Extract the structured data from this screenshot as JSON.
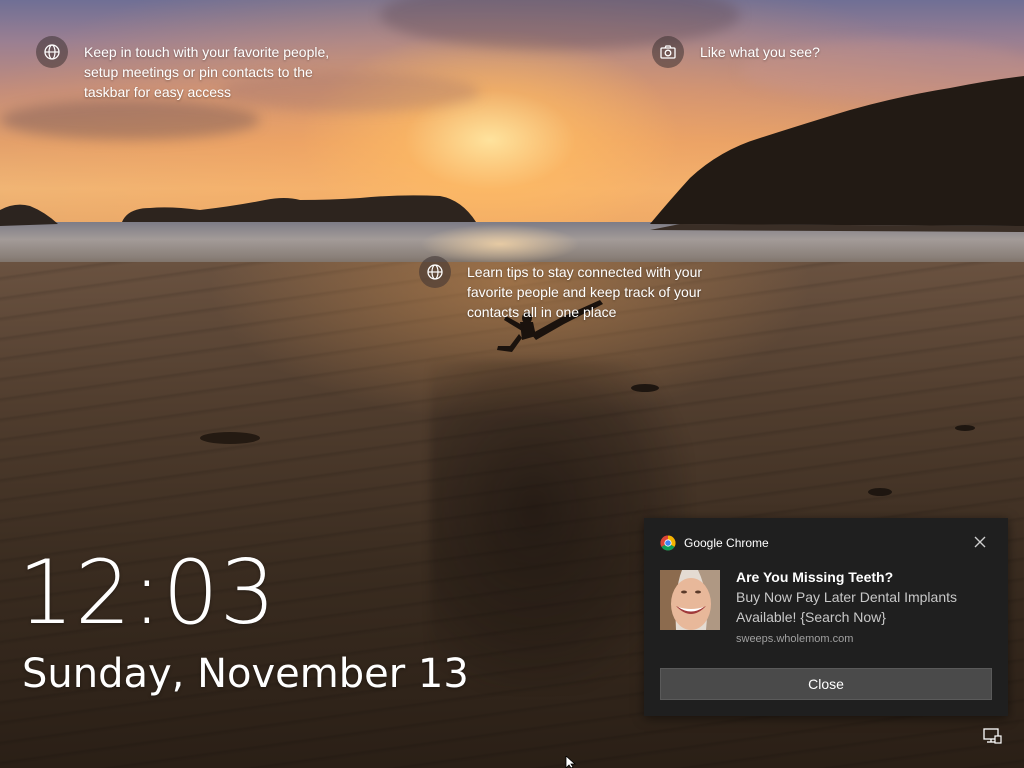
{
  "lock_screen": {
    "spotlight_tips": [
      {
        "icon": "globe-icon",
        "text": "Keep in touch with your favorite people,\nsetup meetings or pin contacts to the\ntaskbar for easy access"
      },
      {
        "icon": "camera-icon",
        "text": "Like what you see?"
      },
      {
        "icon": "globe-icon",
        "text": "Learn tips to stay connected with your\nfavorite people and keep track of your\ncontacts all in one place"
      }
    ],
    "clock": {
      "time": "12:03",
      "date": "Sunday, November 13"
    },
    "notification": {
      "app_name": "Google Chrome",
      "app_icon": "chrome-icon",
      "title": "Are You Missing Teeth?",
      "message": "Buy Now Pay Later Dental Implants\nAvailable! {Search Now}",
      "source": "sweeps.wholemom.com",
      "image": "smiling-woman-thumbnail",
      "close_button_label": "Close",
      "dismiss_icon": "close-icon"
    },
    "tray": {
      "network_icon": "network-icon"
    }
  },
  "colors": {
    "toast_background": "#1f1f1f",
    "toast_button": "#4a4a4a",
    "text": "#ffffff",
    "secondary_text": "#c8c8c8"
  }
}
